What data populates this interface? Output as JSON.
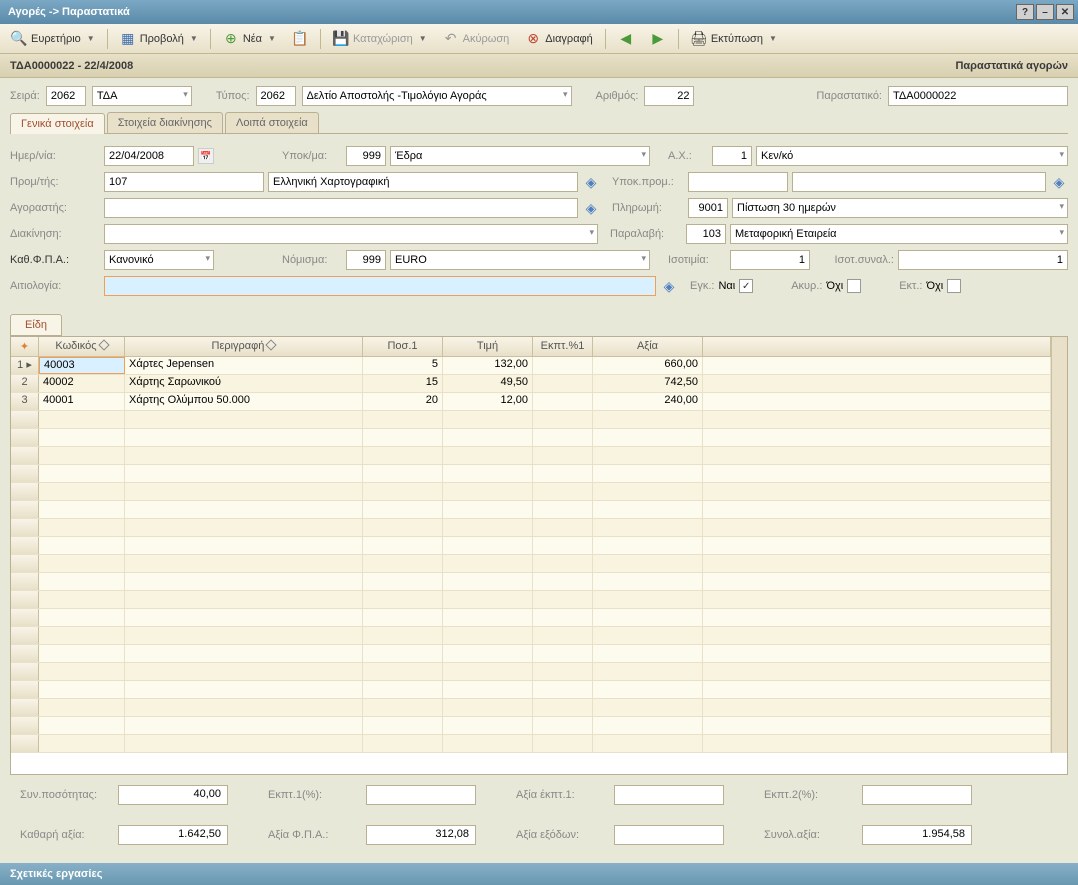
{
  "window": {
    "title": "Αγορές -> Παραστατικά"
  },
  "toolbar": {
    "btn_index": "Ευρετήριο",
    "btn_view": "Προβολή",
    "btn_new": "Νέα",
    "btn_save": "Καταχώριση",
    "btn_cancel": "Ακύρωση",
    "btn_delete": "Διαγραφή",
    "btn_print": "Εκτύπωση"
  },
  "subheader": {
    "left": "ΤΔΑ0000022 - 22/4/2008",
    "right": "Παραστατικά αγορών"
  },
  "top_form": {
    "series_lbl": "Σειρά:",
    "series_code": "2062",
    "series_name": "ΤΔΑ",
    "type_lbl": "Τύπος:",
    "type_code": "2062",
    "type_name": "Δελτίο Αποστολής -Τιμολόγιο Αγοράς",
    "number_lbl": "Αριθμός:",
    "number_val": "22",
    "doc_lbl": "Παραστατικό:",
    "doc_val": "ΤΔΑ0000022"
  },
  "tabs": {
    "general": "Γενικά στοιχεία",
    "movement": "Στοιχεία διακίνησης",
    "other": "Λοιπά στοιχεία"
  },
  "form": {
    "date_lbl": "Ημερ/νία:",
    "date_val": "22/04/2008",
    "branch_lbl": "Υποκ/μα:",
    "branch_code": "999",
    "branch_name": "Έδρα",
    "ax_lbl": "Α.Χ.:",
    "ax_code": "1",
    "ax_name": "Κεν/κό",
    "supplier_lbl": "Προμ/τής:",
    "supplier_code": "107",
    "supplier_name": "Ελληνική Χαρτογραφική",
    "subbranch_lbl": "Υποκ.προμ.:",
    "buyer_lbl": "Αγοραστής:",
    "payment_lbl": "Πληρωμή:",
    "payment_code": "9001",
    "payment_name": "Πίστωση 30 ημερών",
    "movement_lbl": "Διακίνηση:",
    "receipt_lbl": "Παραλαβή:",
    "receipt_code": "103",
    "receipt_name": "Μεταφορική Εταιρεία",
    "vat_lbl": "Καθ.Φ.Π.Α.:",
    "vat_val": "Κανονικό",
    "currency_lbl": "Νόμισμα:",
    "currency_code": "999",
    "currency_name": "EURO",
    "rate_lbl": "Ισοτιμία:",
    "rate_val": "1",
    "rate2_lbl": "Ισοτ.συναλ.:",
    "rate2_val": "1",
    "reason_lbl": "Αιτιολογία:",
    "approved_lbl": "Εγκ.:",
    "approved_val": "Ναι",
    "canceled_lbl": "Ακυρ.:",
    "canceled_val": "Όχι",
    "print_lbl": "Εκτ.:",
    "print_val": "Όχι"
  },
  "items_tab": "Είδη",
  "grid": {
    "headers": {
      "code": "Κωδικός",
      "desc": "Περιγραφή",
      "qty": "Ποσ.1",
      "price": "Τιμή",
      "disc": "Εκπτ.%1",
      "value": "Αξία"
    },
    "rows": [
      {
        "n": "1",
        "code": "40003",
        "desc": "Χάρτες Jepensen",
        "qty": "5",
        "price": "132,00",
        "disc": "",
        "value": "660,00"
      },
      {
        "n": "2",
        "code": "40002",
        "desc": "Χάρτης Σαρωνικού",
        "qty": "15",
        "price": "49,50",
        "disc": "",
        "value": "742,50"
      },
      {
        "n": "3",
        "code": "40001",
        "desc": "Χάρτης Ολύμπου 50.000",
        "qty": "20",
        "price": "12,00",
        "disc": "",
        "value": "240,00"
      }
    ]
  },
  "totals": {
    "qty_lbl": "Συν.ποσότητας:",
    "qty_val": "40,00",
    "disc1_lbl": "Εκπτ.1(%):",
    "disc1_val": "",
    "disc_val_lbl": "Αξία έκπτ.1:",
    "disc_val_val": "",
    "disc2_lbl": "Εκπτ.2(%):",
    "disc2_val": "",
    "net_lbl": "Καθαρή αξία:",
    "net_val": "1.642,50",
    "vat_lbl": "Αξία Φ.Π.Α.:",
    "vat_val": "312,08",
    "exp_lbl": "Αξία εξόδων:",
    "exp_val": "",
    "total_lbl": "Συνολ.αξία:",
    "total_val": "1.954,58"
  },
  "footer": "Σχετικές εργασίες"
}
